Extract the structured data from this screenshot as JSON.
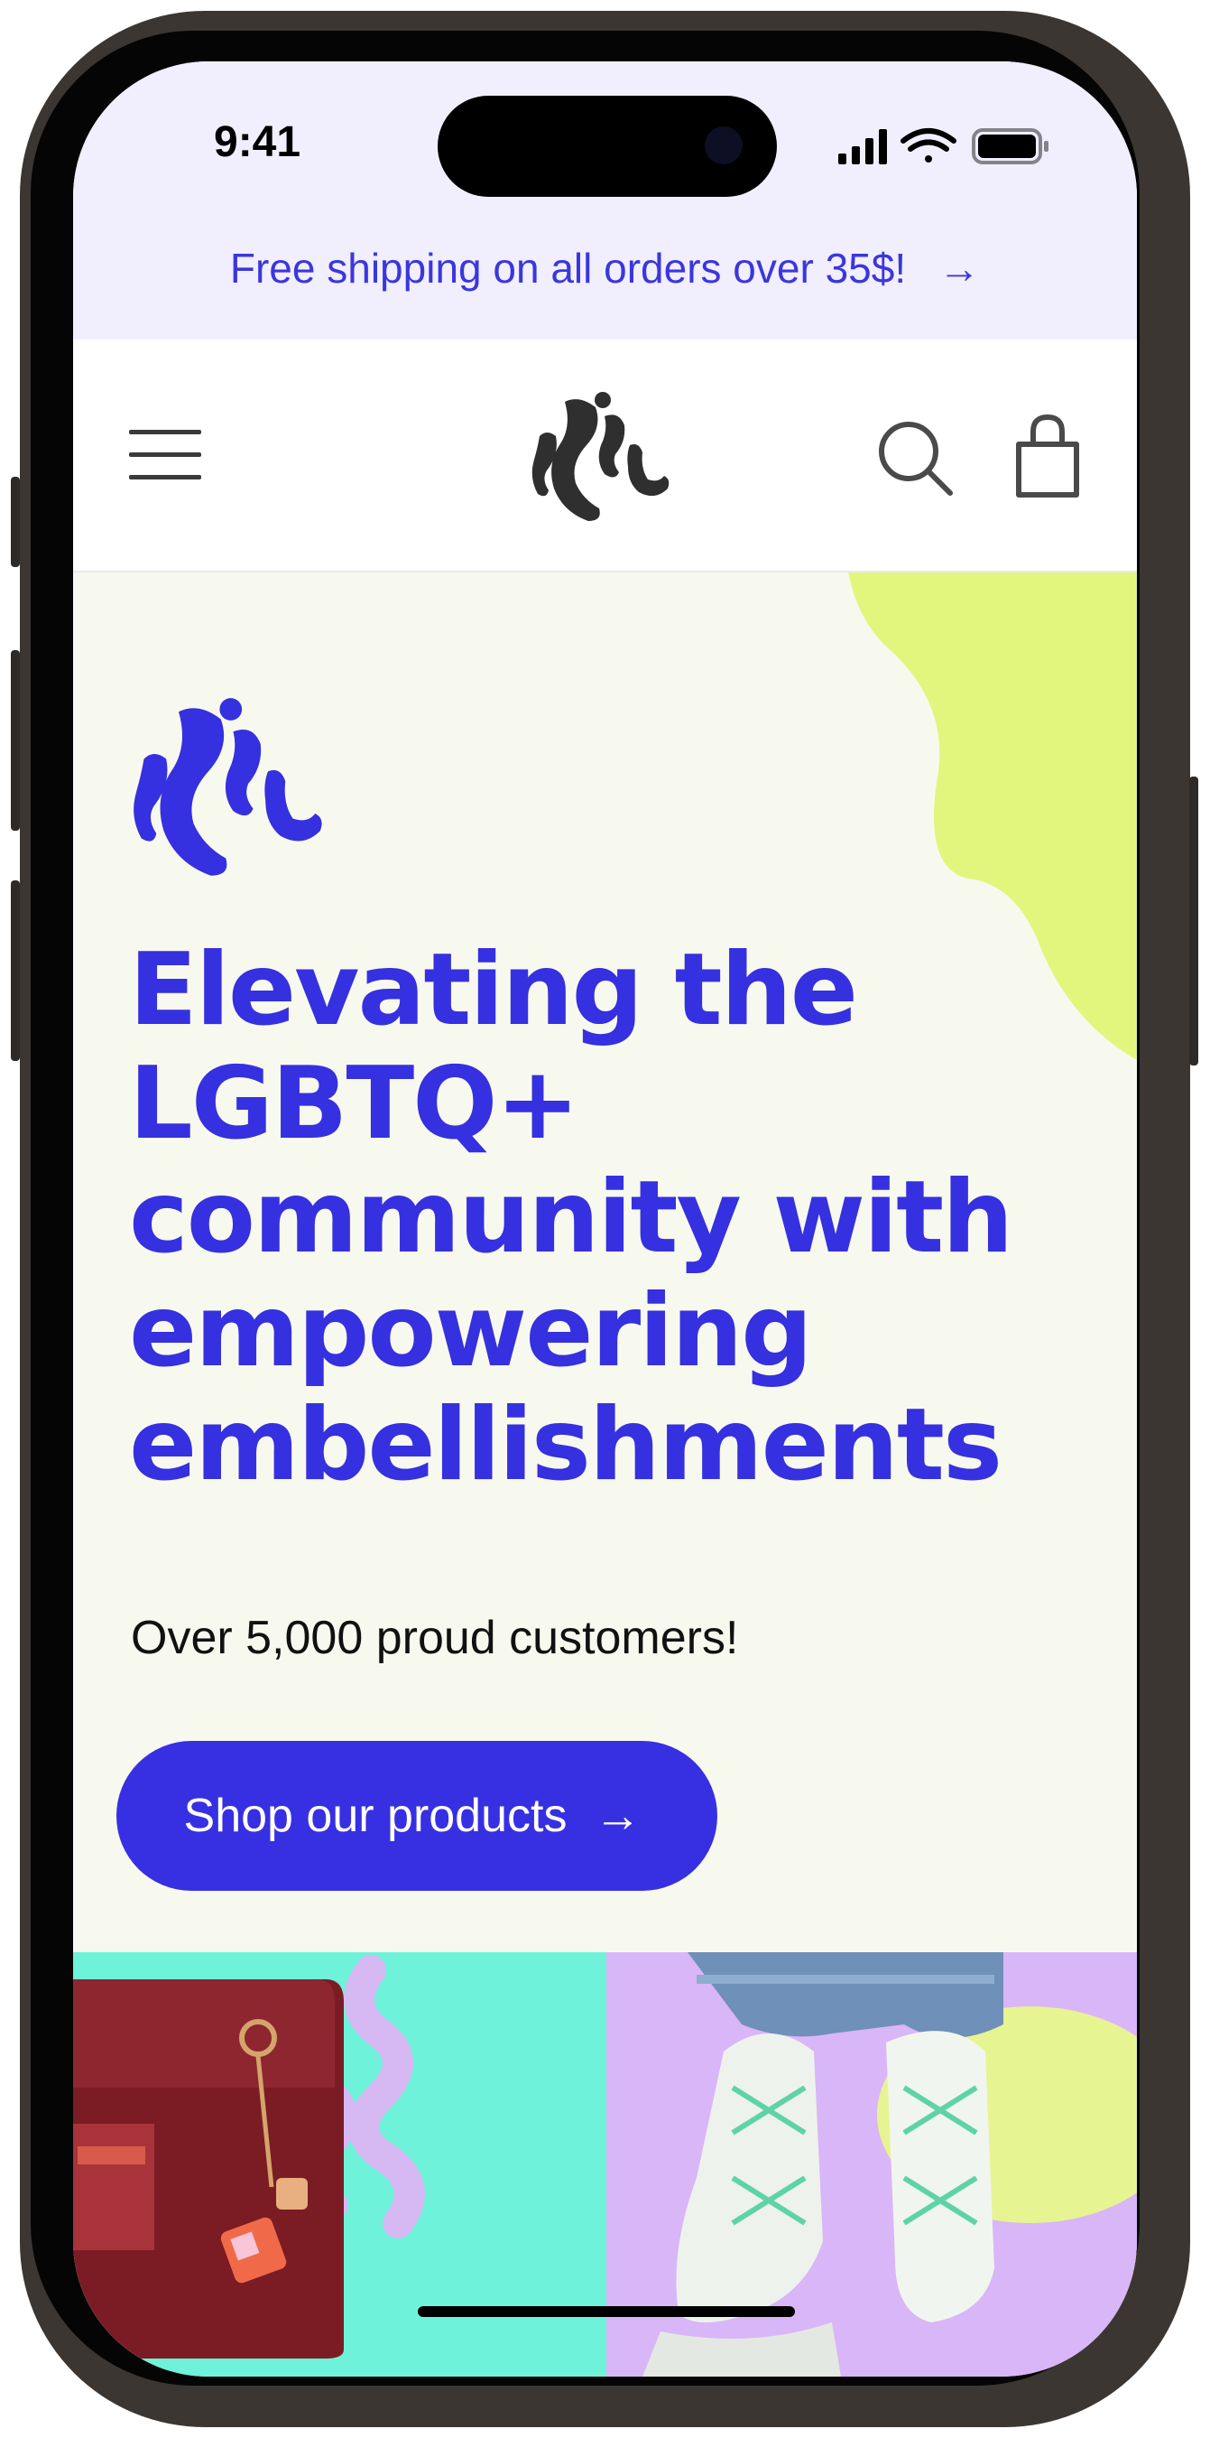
{
  "status_bar": {
    "time": "9:41"
  },
  "promo_bar": {
    "text": "Free shipping on all orders over 35$!",
    "arrow": "→"
  },
  "header": {
    "menu_icon": "hamburger-icon",
    "logo_icon": "brand-logo",
    "search_icon": "search-icon",
    "cart_icon": "shopping-bag-icon"
  },
  "hero": {
    "headline_lines": [
      "Elevating the",
      "LGBTQ+",
      "community with",
      "empowering",
      "embellishments"
    ],
    "subline": "Over 5,000 proud customers!",
    "cta_label": "Shop our products",
    "cta_arrow": "→"
  },
  "colors": {
    "accent": "#3530e0",
    "promo_bg": "#f1effe",
    "hero_bg": "#f8f9ee",
    "lime": "#e2f67e",
    "mint": "#6ef2d9",
    "lavender": "#d9b6f7"
  },
  "product_tiles": [
    {
      "name": "bag-product-image"
    },
    {
      "name": "sneaker-product-image"
    }
  ]
}
